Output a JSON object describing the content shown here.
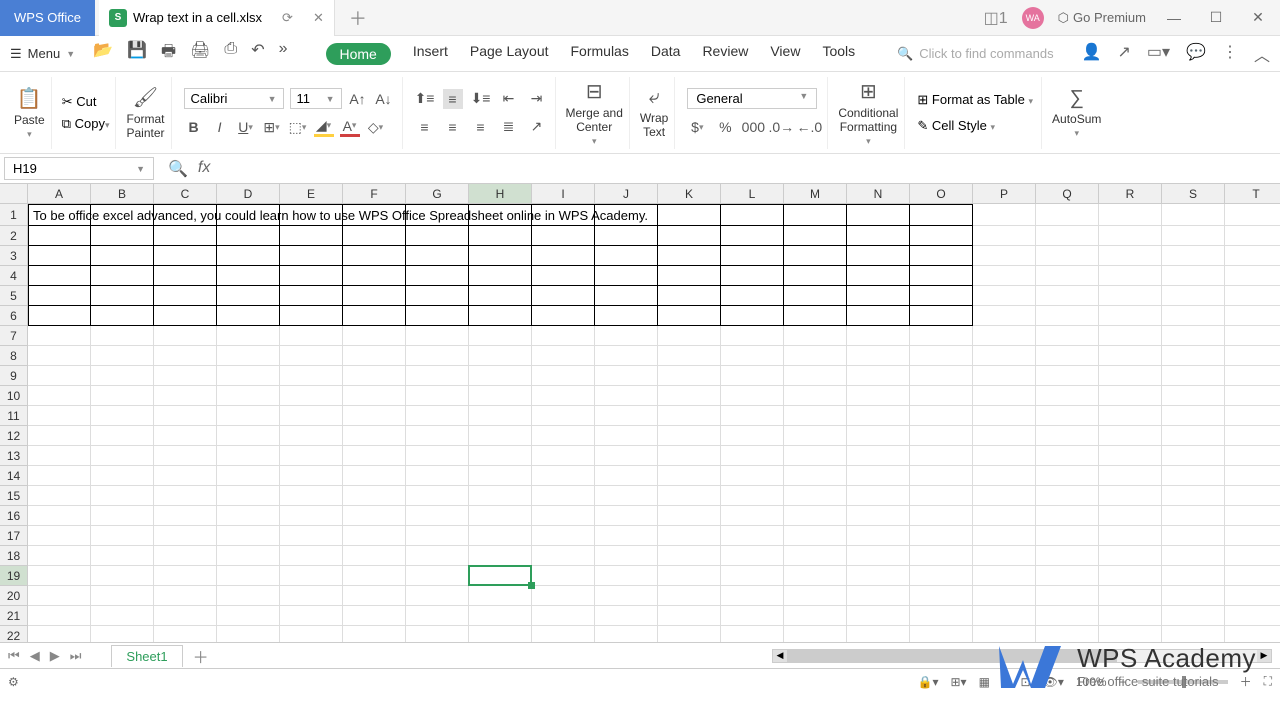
{
  "app": {
    "title": "WPS Office"
  },
  "tab": {
    "name": "Wrap text in a cell.xlsx",
    "icon": "S"
  },
  "titlebar": {
    "go_premium": "Go Premium",
    "avatar": "WA"
  },
  "menu": {
    "label": "Menu"
  },
  "main_tabs": {
    "home": "Home",
    "insert": "Insert",
    "page_layout": "Page Layout",
    "formulas": "Formulas",
    "data": "Data",
    "review": "Review",
    "view": "View",
    "tools": "Tools"
  },
  "search": {
    "placeholder": "Click to find commands"
  },
  "ribbon": {
    "paste": "Paste",
    "cut": "Cut",
    "copy": "Copy",
    "format_painter": "Format\nPainter",
    "font_name": "Calibri",
    "font_size": "11",
    "merge_center": "Merge and\nCenter",
    "wrap_text": "Wrap\nText",
    "number_format": "General",
    "conditional": "Conditional\nFormatting",
    "format_table": "Format as Table",
    "cell_style": "Cell Style",
    "autosum": "AutoSum"
  },
  "name_box": {
    "value": "H19"
  },
  "formula": {
    "value": ""
  },
  "columns": [
    "A",
    "B",
    "C",
    "D",
    "E",
    "F",
    "G",
    "H",
    "I",
    "J",
    "K",
    "L",
    "M",
    "N",
    "O",
    "P",
    "Q",
    "R",
    "S",
    "T"
  ],
  "rows": [
    "1",
    "2",
    "3",
    "4",
    "5",
    "6",
    "7",
    "8",
    "9",
    "10",
    "11",
    "12",
    "13",
    "14",
    "15",
    "16",
    "17",
    "18",
    "19",
    "20",
    "21",
    "22"
  ],
  "cell_a1": "To be office excel advanced, you could learn how to use WPS Office Spreadsheet online in WPS Academy.",
  "selected": {
    "col_index": 7,
    "row_index": 18,
    "ref": "H19"
  },
  "sheet": {
    "name": "Sheet1"
  },
  "status": {
    "zoom": "100%"
  },
  "watermark": {
    "title": "WPS Academy",
    "sub": "Free office suite tutorials"
  }
}
